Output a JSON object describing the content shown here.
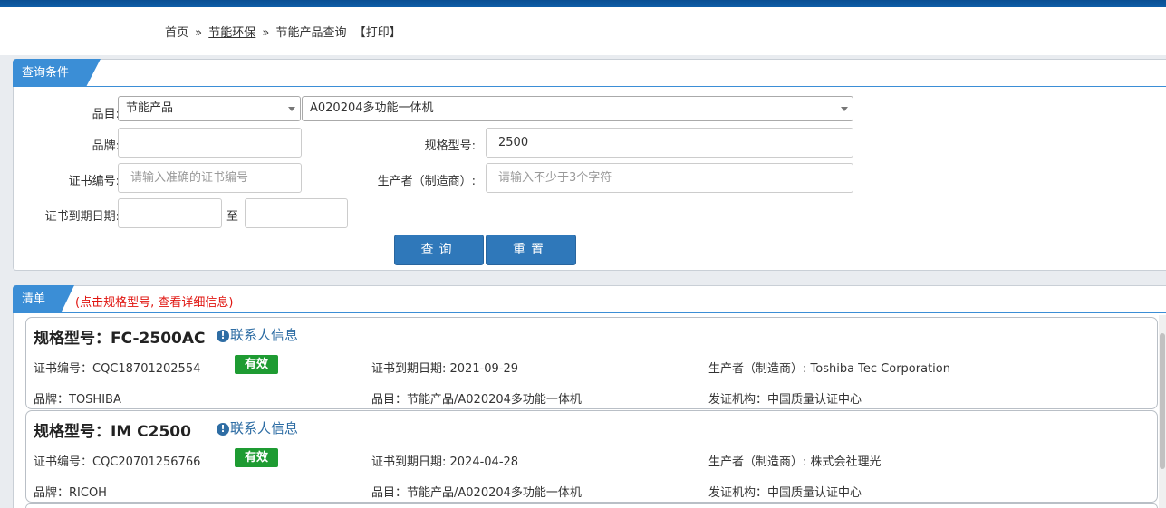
{
  "breadcrumb": {
    "home": "首页",
    "sep1": "»",
    "section": "节能环保",
    "sep2": "»",
    "page": "节能产品查询",
    "print": "【打印】"
  },
  "query_panel": {
    "title": "查询条件",
    "category_label": "品目:",
    "category_value": "节能产品",
    "subcategory_value": "A020204多功能一体机",
    "brand_label": "品牌:",
    "brand_value": "",
    "model_label": "规格型号:",
    "model_value": "2500",
    "cert_label": "证书编号:",
    "cert_placeholder": "请输入准确的证书编号",
    "maker_label": "生产者（制造商）:",
    "maker_placeholder": "请输入不少于3个字符",
    "expiry_label": "证书到期日期:",
    "expiry_from": "",
    "expiry_to_label": "至",
    "expiry_to": "",
    "search_button": "查询",
    "reset_button": "重置"
  },
  "list_panel": {
    "title": "清单",
    "hint": "(点击规格型号, 查看详细信息)"
  },
  "results": [
    {
      "title": "规格型号：FC-2500AC",
      "contact": "联系人信息",
      "cert": "证书编号：CQC18701202554",
      "status": "有效",
      "expiry": "证书到期日期: 2021-09-29",
      "maker": "生产者（制造商）: Toshiba Tec Corporation",
      "brand": "品牌：TOSHIBA",
      "category": "品目：节能产品/A020204多功能一体机",
      "issuer": "发证机构：中国质量认证中心"
    },
    {
      "title": "规格型号：IM C2500",
      "contact": "联系人信息",
      "cert": "证书编号：CQC20701256766",
      "status": "有效",
      "expiry": "证书到期日期: 2024-04-28",
      "maker": "生产者（制造商）: 株式会社理光",
      "brand": "品牌：RICOH",
      "category": "品目：节能产品/A020204多功能一体机",
      "issuer": "发证机构：中国质量认证中心"
    }
  ],
  "colors": {
    "tab_blue": "#3b8ed6",
    "button_blue": "#2f78ba",
    "valid_green": "#1e9b32",
    "hint_red": "#e0140f",
    "link_blue": "#2e6da4"
  },
  "icons": {
    "contact": "info-circle-icon",
    "select_caret": "caret-down-icon"
  }
}
